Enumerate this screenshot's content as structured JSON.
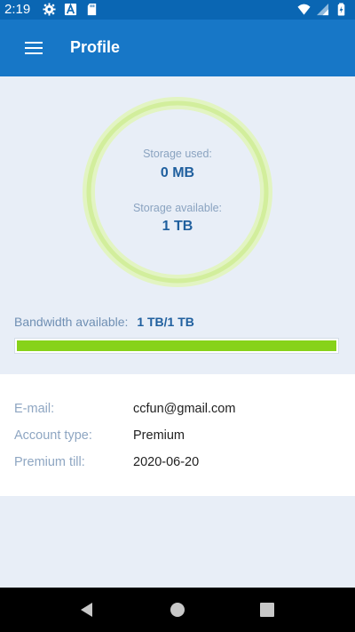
{
  "status_bar": {
    "time": "2:19",
    "icons": [
      "gear-icon",
      "a-icon",
      "sd-card-icon",
      "wifi-icon",
      "signal-icon",
      "battery-icon"
    ]
  },
  "app_bar": {
    "title": "Profile",
    "menu_icon": "hamburger-menu-icon"
  },
  "storage": {
    "used_label": "Storage used:",
    "used_value": "0 MB",
    "available_label": "Storage available:",
    "available_value": "1 TB",
    "ring_color": "#d8f0a8"
  },
  "bandwidth": {
    "label": "Bandwidth available:",
    "value": "1 TB/1 TB",
    "fraction": 1.0,
    "fill_color": "#87d21a"
  },
  "account": {
    "rows": [
      {
        "label": "E-mail:",
        "value": "ccfun@gmail.com"
      },
      {
        "label": "Account type:",
        "value": "Premium"
      },
      {
        "label": "Premium till:",
        "value": "2020-06-20"
      }
    ]
  },
  "nav_bar": {
    "buttons": [
      "back-icon",
      "home-icon",
      "recents-icon"
    ]
  },
  "colors": {
    "status_bar": "#0a66b3",
    "app_bar": "#1777c7",
    "background": "#e8eef7",
    "accent_text": "#1f5f9e"
  }
}
